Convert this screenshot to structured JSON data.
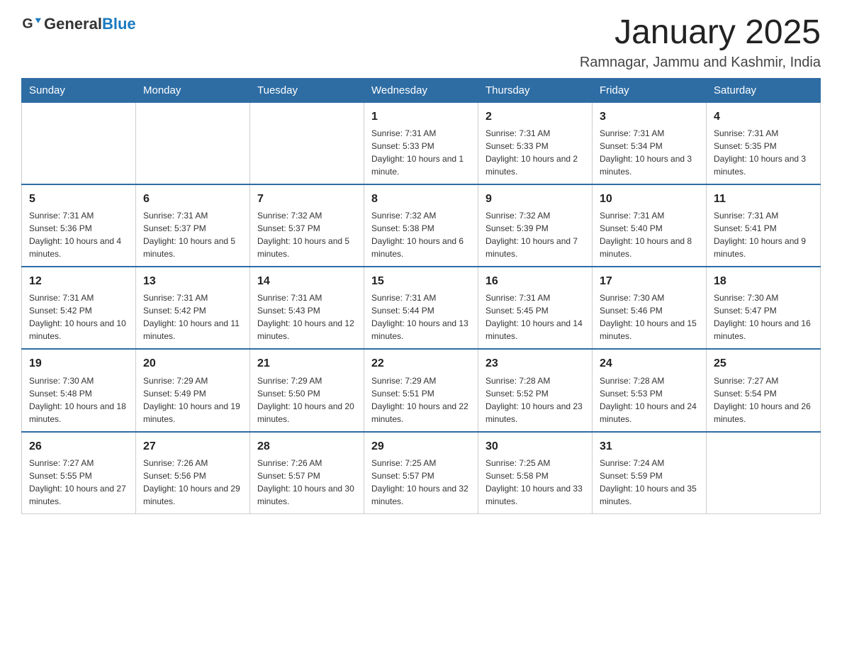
{
  "header": {
    "logo_general": "General",
    "logo_blue": "Blue",
    "month_title": "January 2025",
    "location": "Ramnagar, Jammu and Kashmir, India"
  },
  "weekdays": [
    "Sunday",
    "Monday",
    "Tuesday",
    "Wednesday",
    "Thursday",
    "Friday",
    "Saturday"
  ],
  "weeks": [
    [
      {
        "day": "",
        "info": ""
      },
      {
        "day": "",
        "info": ""
      },
      {
        "day": "",
        "info": ""
      },
      {
        "day": "1",
        "info": "Sunrise: 7:31 AM\nSunset: 5:33 PM\nDaylight: 10 hours and 1 minute."
      },
      {
        "day": "2",
        "info": "Sunrise: 7:31 AM\nSunset: 5:33 PM\nDaylight: 10 hours and 2 minutes."
      },
      {
        "day": "3",
        "info": "Sunrise: 7:31 AM\nSunset: 5:34 PM\nDaylight: 10 hours and 3 minutes."
      },
      {
        "day": "4",
        "info": "Sunrise: 7:31 AM\nSunset: 5:35 PM\nDaylight: 10 hours and 3 minutes."
      }
    ],
    [
      {
        "day": "5",
        "info": "Sunrise: 7:31 AM\nSunset: 5:36 PM\nDaylight: 10 hours and 4 minutes."
      },
      {
        "day": "6",
        "info": "Sunrise: 7:31 AM\nSunset: 5:37 PM\nDaylight: 10 hours and 5 minutes."
      },
      {
        "day": "7",
        "info": "Sunrise: 7:32 AM\nSunset: 5:37 PM\nDaylight: 10 hours and 5 minutes."
      },
      {
        "day": "8",
        "info": "Sunrise: 7:32 AM\nSunset: 5:38 PM\nDaylight: 10 hours and 6 minutes."
      },
      {
        "day": "9",
        "info": "Sunrise: 7:32 AM\nSunset: 5:39 PM\nDaylight: 10 hours and 7 minutes."
      },
      {
        "day": "10",
        "info": "Sunrise: 7:31 AM\nSunset: 5:40 PM\nDaylight: 10 hours and 8 minutes."
      },
      {
        "day": "11",
        "info": "Sunrise: 7:31 AM\nSunset: 5:41 PM\nDaylight: 10 hours and 9 minutes."
      }
    ],
    [
      {
        "day": "12",
        "info": "Sunrise: 7:31 AM\nSunset: 5:42 PM\nDaylight: 10 hours and 10 minutes."
      },
      {
        "day": "13",
        "info": "Sunrise: 7:31 AM\nSunset: 5:42 PM\nDaylight: 10 hours and 11 minutes."
      },
      {
        "day": "14",
        "info": "Sunrise: 7:31 AM\nSunset: 5:43 PM\nDaylight: 10 hours and 12 minutes."
      },
      {
        "day": "15",
        "info": "Sunrise: 7:31 AM\nSunset: 5:44 PM\nDaylight: 10 hours and 13 minutes."
      },
      {
        "day": "16",
        "info": "Sunrise: 7:31 AM\nSunset: 5:45 PM\nDaylight: 10 hours and 14 minutes."
      },
      {
        "day": "17",
        "info": "Sunrise: 7:30 AM\nSunset: 5:46 PM\nDaylight: 10 hours and 15 minutes."
      },
      {
        "day": "18",
        "info": "Sunrise: 7:30 AM\nSunset: 5:47 PM\nDaylight: 10 hours and 16 minutes."
      }
    ],
    [
      {
        "day": "19",
        "info": "Sunrise: 7:30 AM\nSunset: 5:48 PM\nDaylight: 10 hours and 18 minutes."
      },
      {
        "day": "20",
        "info": "Sunrise: 7:29 AM\nSunset: 5:49 PM\nDaylight: 10 hours and 19 minutes."
      },
      {
        "day": "21",
        "info": "Sunrise: 7:29 AM\nSunset: 5:50 PM\nDaylight: 10 hours and 20 minutes."
      },
      {
        "day": "22",
        "info": "Sunrise: 7:29 AM\nSunset: 5:51 PM\nDaylight: 10 hours and 22 minutes."
      },
      {
        "day": "23",
        "info": "Sunrise: 7:28 AM\nSunset: 5:52 PM\nDaylight: 10 hours and 23 minutes."
      },
      {
        "day": "24",
        "info": "Sunrise: 7:28 AM\nSunset: 5:53 PM\nDaylight: 10 hours and 24 minutes."
      },
      {
        "day": "25",
        "info": "Sunrise: 7:27 AM\nSunset: 5:54 PM\nDaylight: 10 hours and 26 minutes."
      }
    ],
    [
      {
        "day": "26",
        "info": "Sunrise: 7:27 AM\nSunset: 5:55 PM\nDaylight: 10 hours and 27 minutes."
      },
      {
        "day": "27",
        "info": "Sunrise: 7:26 AM\nSunset: 5:56 PM\nDaylight: 10 hours and 29 minutes."
      },
      {
        "day": "28",
        "info": "Sunrise: 7:26 AM\nSunset: 5:57 PM\nDaylight: 10 hours and 30 minutes."
      },
      {
        "day": "29",
        "info": "Sunrise: 7:25 AM\nSunset: 5:57 PM\nDaylight: 10 hours and 32 minutes."
      },
      {
        "day": "30",
        "info": "Sunrise: 7:25 AM\nSunset: 5:58 PM\nDaylight: 10 hours and 33 minutes."
      },
      {
        "day": "31",
        "info": "Sunrise: 7:24 AM\nSunset: 5:59 PM\nDaylight: 10 hours and 35 minutes."
      },
      {
        "day": "",
        "info": ""
      }
    ]
  ]
}
